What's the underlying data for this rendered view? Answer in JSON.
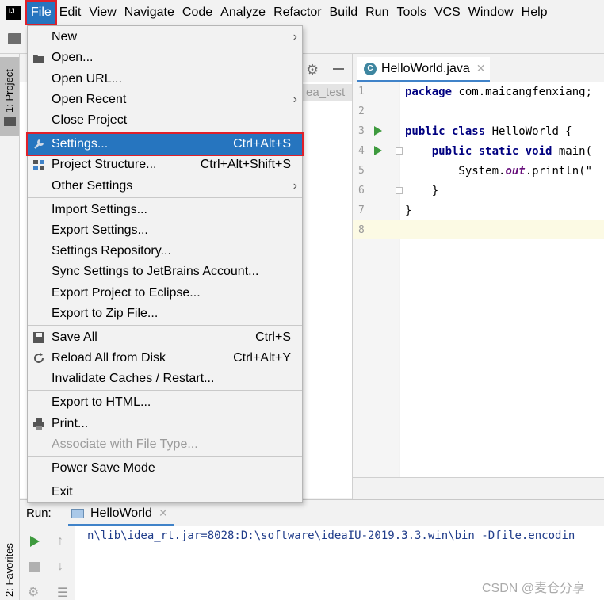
{
  "menubar": {
    "items": [
      "File",
      "Edit",
      "View",
      "Navigate",
      "Code",
      "Analyze",
      "Refactor",
      "Build",
      "Run",
      "Tools",
      "VCS",
      "Window",
      "Help"
    ]
  },
  "left_strip": {
    "project_tab": "1: Project",
    "favorites_tab": "2: Favorites"
  },
  "project_panel": {
    "partial_label": "ea_test"
  },
  "editor": {
    "tab_label": "HelloWorld.java",
    "line_numbers": [
      "1",
      "2",
      "3",
      "4",
      "5",
      "6",
      "7",
      "8"
    ],
    "code": {
      "l1_kw": "package",
      "l1_rest": " com.maicangfenxiang;",
      "l3_kw": "public class",
      "l3_rest": " HelloWorld {",
      "l4_indent": "    ",
      "l4_kw": "public static void",
      "l4_rest": " main(",
      "l5_pre": "        System.",
      "l5_field": "out",
      "l5_rest": ".println(\"",
      "l6": "    }",
      "l7": "}"
    }
  },
  "file_menu": {
    "items": [
      {
        "label": "New",
        "shortcut": "",
        "submenu": true
      },
      {
        "label": "Open...",
        "shortcut": ""
      },
      {
        "label": "Open URL...",
        "shortcut": ""
      },
      {
        "label": "Open Recent",
        "shortcut": "",
        "submenu": true
      },
      {
        "label": "Close Project",
        "shortcut": ""
      },
      {
        "label": "Settings...",
        "shortcut": "Ctrl+Alt+S"
      },
      {
        "label": "Project Structure...",
        "shortcut": "Ctrl+Alt+Shift+S"
      },
      {
        "label": "Other Settings",
        "shortcut": "",
        "submenu": true
      },
      {
        "label": "Import Settings...",
        "shortcut": ""
      },
      {
        "label": "Export Settings...",
        "shortcut": ""
      },
      {
        "label": "Settings Repository...",
        "shortcut": ""
      },
      {
        "label": "Sync Settings to JetBrains Account...",
        "shortcut": ""
      },
      {
        "label": "Export Project to Eclipse...",
        "shortcut": ""
      },
      {
        "label": "Export to Zip File...",
        "shortcut": ""
      },
      {
        "label": "Save All",
        "shortcut": "Ctrl+S"
      },
      {
        "label": "Reload All from Disk",
        "shortcut": "Ctrl+Alt+Y"
      },
      {
        "label": "Invalidate Caches / Restart...",
        "shortcut": ""
      },
      {
        "label": "Export to HTML...",
        "shortcut": ""
      },
      {
        "label": "Print...",
        "shortcut": ""
      },
      {
        "label": "Associate with File Type...",
        "shortcut": ""
      },
      {
        "label": "Power Save Mode",
        "shortcut": ""
      },
      {
        "label": "Exit",
        "shortcut": ""
      }
    ]
  },
  "run_panel": {
    "label": "Run:",
    "tab_label": "HelloWorld",
    "console_line": "n\\lib\\idea_rt.jar=8028:D:\\software\\ideaIU-2019.3.3.win\\bin -Dfile.encodin"
  },
  "watermark": "CSDN @麦仓分享",
  "colors": {
    "selection": "#2675bf",
    "highlight_border": "#e0202a",
    "run_green": "#3e9a3e"
  }
}
